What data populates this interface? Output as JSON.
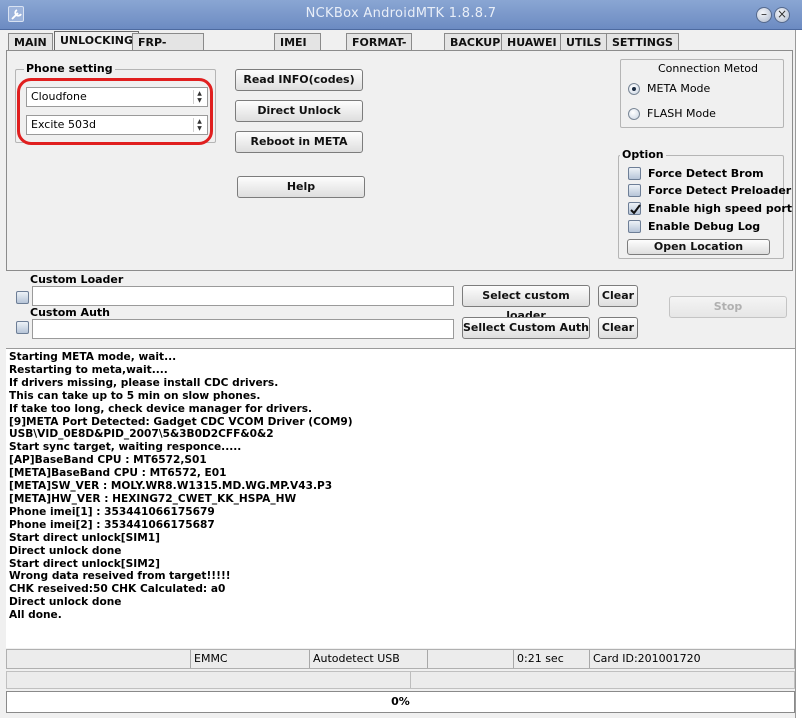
{
  "window": {
    "title": "NCKBox AndroidMTK 1.8.8.7"
  },
  "tabs": [
    "MAIN",
    "UNLOCKING",
    "FRP-PATTERN-PRIVACY",
    "IMEI UTILS",
    "FORMAT-RESET",
    "BACKUP",
    "HUAWEI",
    "UTILS",
    "SETTINGS"
  ],
  "active_tab": "UNLOCKING",
  "phone_setting": {
    "title": "Phone setting",
    "brand": "Cloudfone",
    "model": "Excite 503d"
  },
  "actions": {
    "read_info": "Read INFO(codes)",
    "direct_unlock": "Direct Unlock",
    "reboot_meta": "Reboot in META",
    "help": "Help"
  },
  "connection": {
    "title": "Connection Metod",
    "meta_mode": "META Mode",
    "flash_mode": "FLASH Mode",
    "selected": "META Mode"
  },
  "options": {
    "title": "Option",
    "force_detect_brom": "Force Detect Brom",
    "force_detect_preloader": "Force Detect Preloader",
    "enable_high_speed_port": "Enable high speed port",
    "enable_debug_log": "Enable Debug Log",
    "open_location": "Open Location"
  },
  "custom_loader": {
    "label": "Custom Loader",
    "select_button": "Select custom loader",
    "clear_button": "Clear"
  },
  "custom_auth": {
    "label": "Custom Auth",
    "select_button": "Sellect Custom Auth",
    "clear_button": "Clear"
  },
  "stop_button": "Stop",
  "log": [
    "Starting META mode, wait...",
    "Restarting to meta,wait....",
    "If drivers missing, please install CDC drivers.",
    "This can take up to 5 min on slow phones.",
    "If take too long, check device manager for drivers.",
    "[9]META Port Detected: Gadget CDC VCOM Driver (COM9)",
    "USB\\VID_0E8D&PID_2007\\5&3B0D2CFF&0&2",
    "Start sync target, waiting responce.....",
    "[AP]BaseBand CPU : MT6572,S01",
    "[META]BaseBand CPU : MT6572, E01",
    "[META]SW_VER : MOLY.WR8.W1315.MD.WG.MP.V43.P3",
    "[META]HW_VER : HEXING72_CWET_KK_HSPA_HW",
    "Phone imei[1] : 353441066175679",
    "Phone imei[2] : 353441066175687",
    "Start direct unlock[SIM1]",
    "Direct unlock done",
    "Start direct unlock[SIM2]",
    "Wrong data reseived from target!!!!!",
    "CHK reseived:50   CHK Calculated: a0",
    "Direct unlock done",
    "All done."
  ],
  "status": {
    "storage": "EMMC",
    "usb": "Autodetect USB",
    "time": "0:21 sec",
    "card_id": "Card ID:201001720"
  },
  "progress": {
    "value": 0,
    "label": "0%"
  },
  "colors": {
    "highlight_ring": "#e01f1f",
    "titlebar": "#7896ca"
  }
}
